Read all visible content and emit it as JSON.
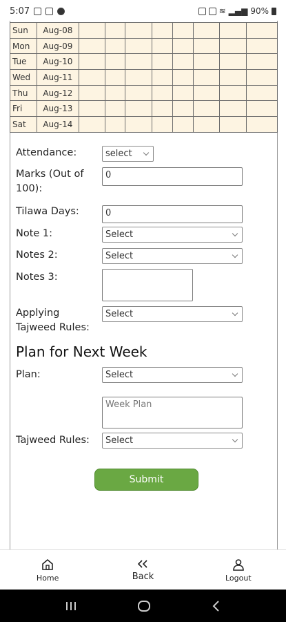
{
  "status_bar": {
    "time": "5:07",
    "battery": "90%"
  },
  "week_table": {
    "rows": [
      {
        "day": "Sun",
        "date": "Aug-08"
      },
      {
        "day": "Mon",
        "date": "Aug-09"
      },
      {
        "day": "Tue",
        "date": "Aug-10"
      },
      {
        "day": "Wed",
        "date": "Aug-11"
      },
      {
        "day": "Thu",
        "date": "Aug-12"
      },
      {
        "day": "Fri",
        "date": "Aug-13"
      },
      {
        "day": "Sat",
        "date": "Aug-14"
      }
    ]
  },
  "form": {
    "attendance_label": "Attendance:",
    "attendance_value": "select",
    "marks_label": "Marks (Out of 100):",
    "marks_value": "0",
    "tilawa_label": "Tilawa Days:",
    "tilawa_value": "0",
    "note1_label": "Note 1:",
    "note1_value": "Select",
    "notes2_label": "Notes 2:",
    "notes2_value": "Select",
    "notes3_label": "Notes 3:",
    "notes3_value": "",
    "tajweed_apply_label": "Applying Tajweed Rules:",
    "tajweed_apply_value": "Select"
  },
  "plan": {
    "title": "Plan for Next Week",
    "plan_label": "Plan:",
    "plan_value": "Select",
    "week_plan_placeholder": "Week Plan",
    "tajweed_label": "Tajweed Rules:",
    "tajweed_value": "Select"
  },
  "submit_label": "Submit",
  "bottom_nav": {
    "home": "Home",
    "back": "Back",
    "logout": "Logout"
  },
  "colors": {
    "table_bg": "#fdf4e2",
    "submit_bg": "#6aa843"
  }
}
